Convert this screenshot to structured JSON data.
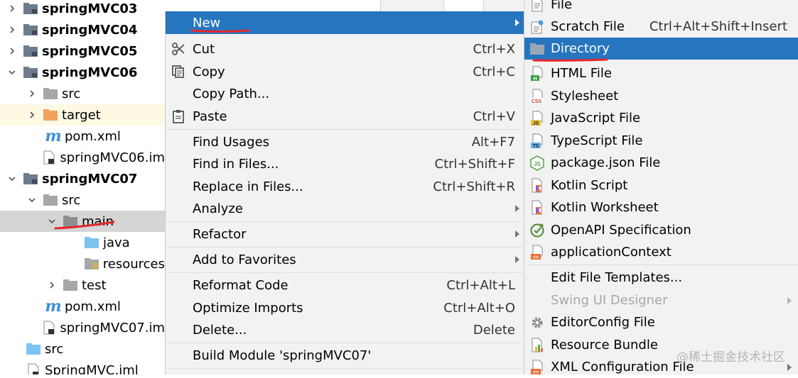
{
  "project_tree": {
    "items": [
      {
        "label": "springMVC03",
        "bold": true
      },
      {
        "label": "springMVC04",
        "bold": true
      },
      {
        "label": "springMVC05",
        "bold": true
      },
      {
        "label": "springMVC06",
        "bold": true
      },
      {
        "label": "src"
      },
      {
        "label": "target"
      },
      {
        "label": "pom.xml"
      },
      {
        "label": "springMVC06.im"
      },
      {
        "label": "springMVC07",
        "bold": true
      },
      {
        "label": "src"
      },
      {
        "label": "main"
      },
      {
        "label": "java"
      },
      {
        "label": "resources"
      },
      {
        "label": "test"
      },
      {
        "label": "pom.xml"
      },
      {
        "label": "springMVC07.im"
      },
      {
        "label": "src"
      },
      {
        "label": "SpringMVC.iml"
      }
    ]
  },
  "context_menu": {
    "items": [
      {
        "label": "New",
        "shortcut": ""
      },
      {
        "label": "Cut",
        "shortcut": "Ctrl+X"
      },
      {
        "label": "Copy",
        "shortcut": "Ctrl+C"
      },
      {
        "label": "Copy Path...",
        "shortcut": ""
      },
      {
        "label": "Paste",
        "shortcut": "Ctrl+V"
      },
      {
        "label": "Find Usages",
        "shortcut": "Alt+F7"
      },
      {
        "label": "Find in Files...",
        "shortcut": "Ctrl+Shift+F"
      },
      {
        "label": "Replace in Files...",
        "shortcut": "Ctrl+Shift+R"
      },
      {
        "label": "Analyze",
        "shortcut": ""
      },
      {
        "label": "Refactor",
        "shortcut": ""
      },
      {
        "label": "Add to Favorites",
        "shortcut": ""
      },
      {
        "label": "Reformat Code",
        "shortcut": "Ctrl+Alt+L"
      },
      {
        "label": "Optimize Imports",
        "shortcut": "Ctrl+Alt+O"
      },
      {
        "label": "Delete...",
        "shortcut": "Delete"
      },
      {
        "label": "Build Module 'springMVC07'",
        "shortcut": ""
      }
    ]
  },
  "new_submenu": {
    "items": [
      {
        "label": "File",
        "shortcut": ""
      },
      {
        "label": "Scratch File",
        "shortcut": "Ctrl+Alt+Shift+Insert"
      },
      {
        "label": "Directory",
        "shortcut": ""
      },
      {
        "label": "HTML File",
        "shortcut": ""
      },
      {
        "label": "Stylesheet",
        "shortcut": ""
      },
      {
        "label": "JavaScript File",
        "shortcut": ""
      },
      {
        "label": "TypeScript File",
        "shortcut": ""
      },
      {
        "label": "package.json File",
        "shortcut": ""
      },
      {
        "label": "Kotlin Script",
        "shortcut": ""
      },
      {
        "label": "Kotlin Worksheet",
        "shortcut": ""
      },
      {
        "label": "OpenAPI Specification",
        "shortcut": ""
      },
      {
        "label": "applicationContext",
        "shortcut": ""
      },
      {
        "label": "Edit File Templates...",
        "shortcut": ""
      },
      {
        "label": "Swing UI Designer",
        "shortcut": ""
      },
      {
        "label": "EditorConfig File",
        "shortcut": ""
      },
      {
        "label": "Resource Bundle",
        "shortcut": ""
      },
      {
        "label": "XML Configuration File",
        "shortcut": ""
      }
    ]
  },
  "watermark": "@稀土掘金技术社区",
  "colors": {
    "selection_blue": "#2675bf",
    "menu_bg": "#f2f2f2",
    "tree_selection": "#d5d5d5",
    "excluded_folder": "#f0a35e",
    "module_folder": "#6d7c8c",
    "source_folder": "#7cc4ef",
    "annotation_red": "#e8262b"
  }
}
